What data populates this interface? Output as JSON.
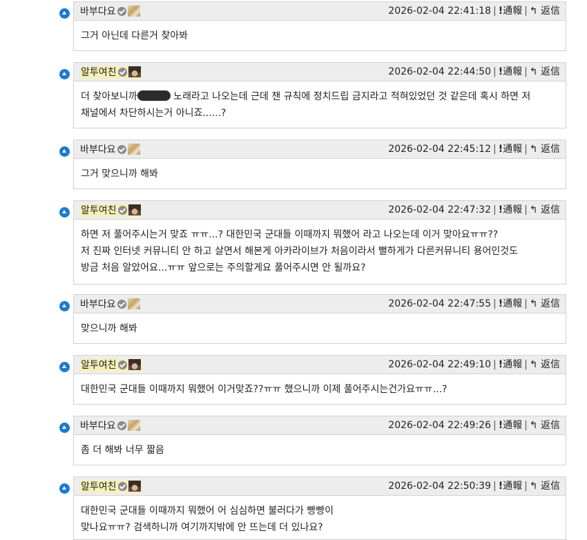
{
  "actions": {
    "report": "通報",
    "reply": "返信",
    "report_mark": "!",
    "reply_mark": "↰"
  },
  "comments": [
    {
      "author": "바부다요",
      "timestamp": "2026-02-04 22:41:18",
      "lines": [
        "그거 아닌데 다른거 찾아봐"
      ]
    },
    {
      "author": "알투여친",
      "timestamp": "2026-02-04 22:44:50",
      "line1_before": "더 찾아보니까",
      "line1_after": " 노래라고 나오는데 근데 챈 규칙에 정치드립 금지라고 적혀있었던 것 같은데 혹시 하면 저",
      "lines": [
        "채널에서 차단하시는거 아니죠......?"
      ]
    },
    {
      "author": "바부다요",
      "timestamp": "2026-02-04 22:45:12",
      "lines": [
        "그거 맞으니까 해봐"
      ]
    },
    {
      "author": "알투여친",
      "timestamp": "2026-02-04 22:47:32",
      "lines": [
        "하면 저 풀어주시는거 맞죠 ㅠㅠ...?  대한민국 군대들 이때까지 뭐했어 라고 나오는데 이거 맞아요ㅠㅠ??",
        "저 진짜 인터넷 커뮤니티 안 하고 살면서 해본게 아카라이브가 처음이라서 뻘하게가 다른커뮤니티 용어인것도",
        "방금 처음 알았어요...ㅠㅠ 앞으로는 주의할게요 풀어주시면 안 될까요?"
      ]
    },
    {
      "author": "바부다요",
      "timestamp": "2026-02-04 22:47:55",
      "lines": [
        "맞으니까 해봐"
      ]
    },
    {
      "author": "알투여친",
      "timestamp": "2026-02-04 22:49:10",
      "lines": [
        "대한민국 군대들 이때까지 뭐했어 이거맞죠??ㅠㅠ 했으니까 이제 풀어주시는건가요ㅠㅠ...?"
      ]
    },
    {
      "author": "바부다요",
      "timestamp": "2026-02-04 22:49:26",
      "lines": [
        "좀 더 해봐 너무 짧음"
      ]
    },
    {
      "author": "알투여친",
      "timestamp": "2026-02-04 22:50:39",
      "lines": [
        "대한민국 군대들 이때까지 뭐했어 어 심심하면 불러다가 빵빵이",
        "맞나요ㅠㅠ? 검색하니까 여기까지밖에 안 뜨는데 더 있나요?"
      ]
    }
  ]
}
